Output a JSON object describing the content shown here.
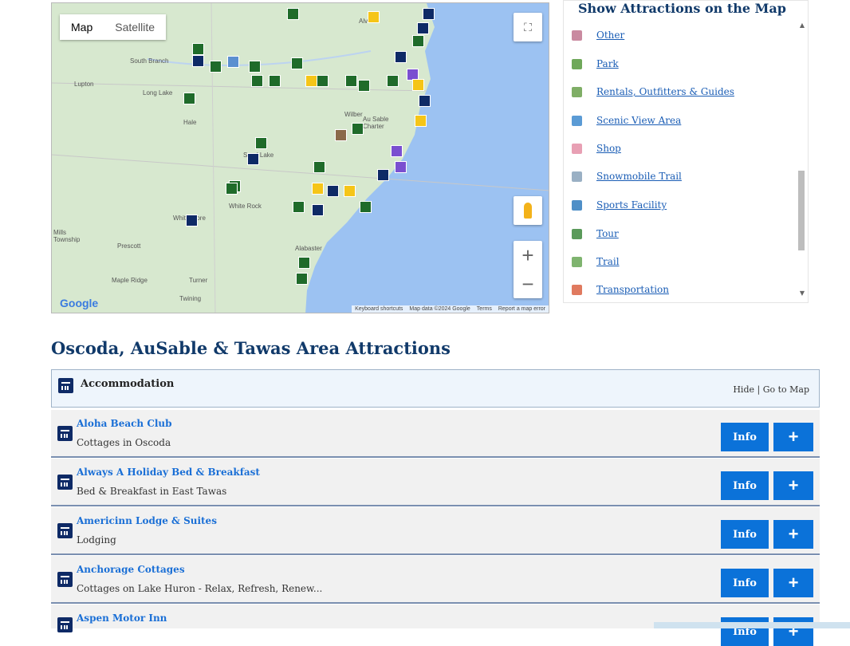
{
  "map": {
    "toggle": {
      "map": "Map",
      "satellite": "Satellite"
    },
    "google": "Google",
    "attribution": [
      "Keyboard shortcuts",
      "Map data ©2024 Google",
      "Terms",
      "Report a map error"
    ],
    "places": [
      "South Branch",
      "Lupton",
      "Long Lake",
      "Hale",
      "Alvin",
      "Wilber",
      "Au Sable Charter",
      "Sand Lake",
      "White Rock",
      "Whittemore",
      "Mills Township",
      "Prescott",
      "Alabaster",
      "Maple Ridge",
      "Turner",
      "Twining"
    ],
    "zoom_in": "+",
    "zoom_out": "−"
  },
  "panel": {
    "title": "Show Attractions on the Map",
    "categories": [
      {
        "label": "Other",
        "color": "#c98aa0"
      },
      {
        "label": "Park",
        "color": "#6fa85a"
      },
      {
        "label": "Rentals, Outfitters & Guides",
        "color": "#7fae66"
      },
      {
        "label": "Scenic View Area",
        "color": "#5b9bd5"
      },
      {
        "label": "Shop",
        "color": "#e8a0b4"
      },
      {
        "label": "Snowmobile Trail",
        "color": "#9ab0c4"
      },
      {
        "label": "Sports Facility",
        "color": "#4f8fc7"
      },
      {
        "label": "Tour",
        "color": "#5a9a5a"
      },
      {
        "label": "Trail",
        "color": "#7fb46f"
      },
      {
        "label": "Transportation",
        "color": "#e07a5f"
      }
    ]
  },
  "section": {
    "title": "Oscoda, AuSable & Tawas Area Attractions",
    "category": "Accommodation",
    "actions": "Hide | Go to Map"
  },
  "listings": [
    {
      "name": "Aloha Beach Club",
      "desc": "Cottages in Oscoda"
    },
    {
      "name": "Always A Holiday Bed & Breakfast",
      "desc": "Bed & Breakfast in East Tawas"
    },
    {
      "name": "Americinn Lodge & Suites",
      "desc": "Lodging"
    },
    {
      "name": "Anchorage Cottages",
      "desc": "Cottages on Lake Huron - Relax, Refresh, Renew..."
    },
    {
      "name": "Aspen Motor Inn",
      "desc": ""
    }
  ],
  "buttons": {
    "info": "Info",
    "plus": "+"
  },
  "colors": {
    "accent": "#0b72d9",
    "heading": "#113a6a",
    "link": "#1a6fd6"
  }
}
